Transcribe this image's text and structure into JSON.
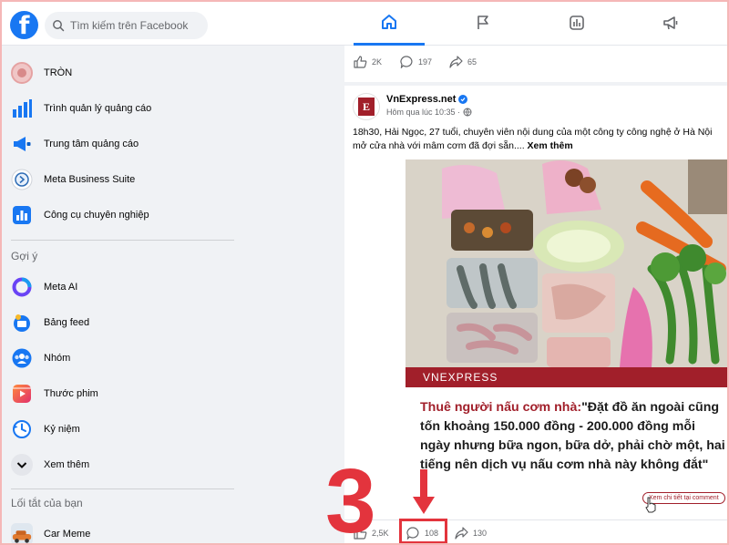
{
  "topbar": {
    "logo_letter": "f",
    "search_placeholder": "Tìm kiếm trên Facebook",
    "tabs": [
      {
        "icon": "home-icon",
        "active": true
      },
      {
        "icon": "flag-icon",
        "active": false
      },
      {
        "icon": "insights-icon",
        "active": false
      },
      {
        "icon": "megaphone-icon",
        "active": false
      }
    ],
    "accent_color": "#1877f2"
  },
  "sidebar": {
    "items": [
      {
        "label": "TRÒN",
        "icon": "profile-avatar"
      },
      {
        "label": "Trình quản lý quảng cáo",
        "icon": "ads-manager-icon"
      },
      {
        "label": "Trung tâm quảng cáo",
        "icon": "ad-center-icon"
      },
      {
        "label": "Meta Business Suite",
        "icon": "business-suite-icon"
      },
      {
        "label": "Công cụ chuyên nghiệp",
        "icon": "professional-tools-icon"
      }
    ],
    "suggest_heading": "Gợi ý",
    "suggest_items": [
      {
        "label": "Meta AI",
        "icon": "meta-ai-icon"
      },
      {
        "label": "Bảng feed",
        "icon": "feed-icon"
      },
      {
        "label": "Nhóm",
        "icon": "groups-icon"
      },
      {
        "label": "Thước phim",
        "icon": "reels-icon"
      },
      {
        "label": "Kỷ niệm",
        "icon": "memories-icon"
      },
      {
        "label": "Xem thêm",
        "icon": "chevron-down-icon"
      }
    ],
    "shortcuts_heading": "Lối tắt của bạn",
    "shortcuts": [
      {
        "label": "Car Meme",
        "icon": "car-meme-avatar"
      }
    ]
  },
  "feed": {
    "prev_post": {
      "likes": "2K",
      "comments": "197",
      "shares": "65"
    },
    "post": {
      "page_name": "VnExpress.net",
      "time": "Hôm qua lúc 10:35 ·",
      "text": "18h30, Hải Ngọc, 27 tuổi, chuyên viên nội dung của một công ty công nghệ ở Hà Nội mở cửa nhà với mâm cơm đã đợi sẵn.... ",
      "see_more": "Xem thêm",
      "image_brand": "VNEXPRESS",
      "headline_lead": "Thuê người nấu cơm nhà:",
      "headline_rest": "\"Đặt đồ ăn ngoài cũng tốn khoảng 150.000 đồng - 200.000 đồng mỗi ngày nhưng bữa ngon, bữa dở, phải chờ một, hai tiếng nên dịch vụ nấu cơm nhà này không đắt\"",
      "image_button": "Xem chi tiết tại comment",
      "likes": "2,5K",
      "comments": "108",
      "shares": "130",
      "brand_color": "#a11f2a"
    }
  },
  "annotation": {
    "step_number": "3",
    "color": "#e3343d"
  }
}
